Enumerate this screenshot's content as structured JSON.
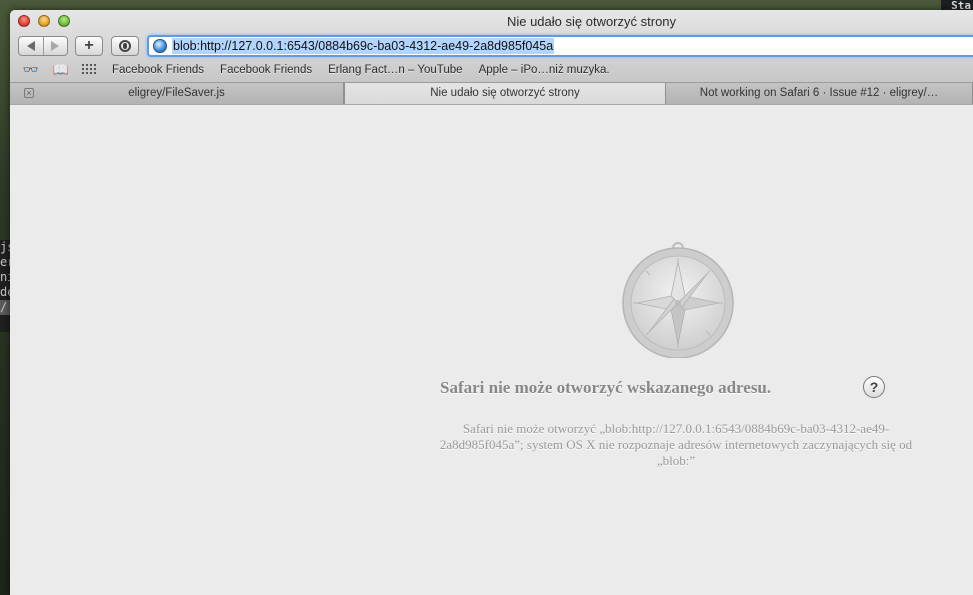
{
  "desktop": {
    "corner_text": "Sta",
    "terminal_lines": [
      "js",
      "er",
      "ni",
      "de",
      "/"
    ]
  },
  "window": {
    "title": "Nie udało się otworzyć strony"
  },
  "toolbar": {
    "add_label": "+",
    "address_url": "blob:http://127.0.0.1:6543/0884b69c-ba03-4312-ae49-2a8d985f045a"
  },
  "bookmarks": {
    "icons": [
      "reading-list-icon",
      "bookmarks-book-icon",
      "top-sites-grid-icon"
    ],
    "items": [
      {
        "label": "Facebook Friends"
      },
      {
        "label": "Facebook Friends"
      },
      {
        "label": "Erlang Fact…n – YouTube"
      },
      {
        "label": "Apple – iPo…niż muzyka."
      }
    ]
  },
  "tabs": [
    {
      "label": "eligrey/FileSaver.js",
      "active": false
    },
    {
      "label": "Nie udało się otworzyć strony",
      "active": true
    },
    {
      "label": "Not working on Safari 6 · Issue #12 · eligrey/…",
      "active": false
    }
  ],
  "error": {
    "title": "Safari nie może otworzyć wskazanego adresu.",
    "help_label": "?",
    "description": "Safari nie może otworzyć „blob:http://127.0.0.1:6543/0884b69c-ba03-4312-ae49-2a8d985f045a”; system OS X nie rozpoznaje adresów internetowych zaczynających się od „blob:”"
  },
  "colors": {
    "address_focus": "#5b9be8",
    "selection": "#b3d4fc",
    "error_text": "#888888"
  }
}
